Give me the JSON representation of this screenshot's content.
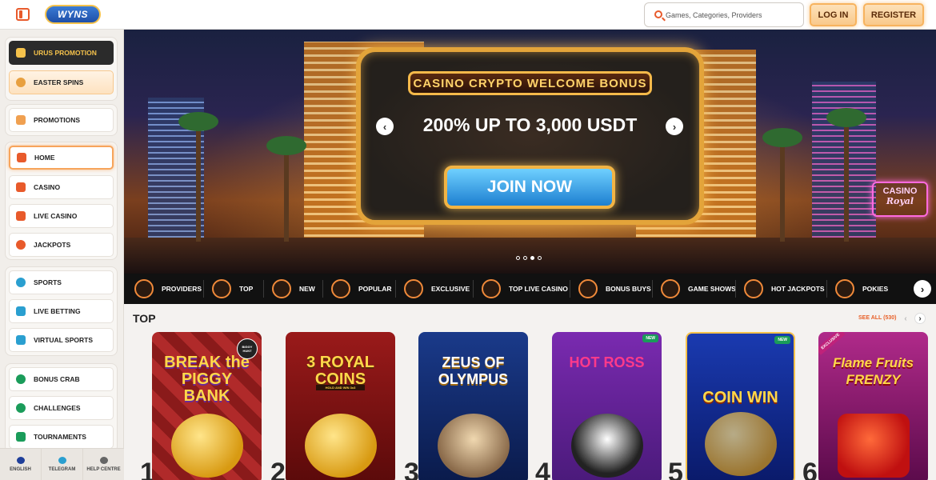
{
  "header": {
    "logo_text": "WYNS",
    "search_placeholder": "Games, Categories, Providers",
    "login_label": "LOG IN",
    "register_label": "REGISTER"
  },
  "sidebar": {
    "promo_items": [
      {
        "label": "URUS PROMOTION",
        "icon": "car-icon"
      },
      {
        "label": "EASTER SPINS",
        "icon": "easter-egg-icon"
      }
    ],
    "promotions_label": "PROMOTIONS",
    "nav_items": [
      {
        "label": "HOME",
        "icon": "home-icon"
      },
      {
        "label": "CASINO",
        "icon": "slot-machine-icon"
      },
      {
        "label": "LIVE CASINO",
        "icon": "cards-icon"
      },
      {
        "label": "JACKPOTS",
        "icon": "clover-icon"
      }
    ],
    "sports_items": [
      {
        "label": "SPORTS",
        "icon": "ball-icon"
      },
      {
        "label": "LIVE BETTING",
        "icon": "live-icon"
      },
      {
        "label": "VIRTUAL SPORTS",
        "icon": "monitor-icon"
      }
    ],
    "extra_items": [
      {
        "label": "BONUS CRAB",
        "icon": "claw-icon"
      },
      {
        "label": "CHALLENGES",
        "icon": "medal-icon"
      },
      {
        "label": "TOURNAMENTS",
        "icon": "trophy-icon"
      }
    ],
    "footer": [
      {
        "label": "ENGLISH",
        "icon": "flag-icon"
      },
      {
        "label": "TELEGRAM",
        "icon": "telegram-icon"
      },
      {
        "label": "HELP CENTRE",
        "icon": "help-icon"
      }
    ]
  },
  "banner": {
    "title": "CASINO CRYPTO WELCOME BONUS",
    "headline": "200% UP TO 3,000 USDT",
    "cta_label": "JOIN NOW",
    "sign_text": "CASINO",
    "sign_script": "Royal",
    "slides_count": 4,
    "active_slide": 2
  },
  "categories": [
    {
      "label": "PROVIDERS",
      "icon": "providers-icon"
    },
    {
      "label": "TOP",
      "icon": "crown-icon"
    },
    {
      "label": "NEW",
      "icon": "lightning-icon"
    },
    {
      "label": "POPULAR",
      "icon": "fire-icon"
    },
    {
      "label": "EXCLUSIVE",
      "icon": "diamond-icon"
    },
    {
      "label": "TOP LIVE CASINO",
      "icon": "star-icon"
    },
    {
      "label": "BONUS BUYS",
      "icon": "gift-icon"
    },
    {
      "label": "GAME SHOWS",
      "icon": "microphone-icon"
    },
    {
      "label": "HOT JACKPOTS",
      "icon": "coins-icon"
    },
    {
      "label": "POKIES",
      "icon": "slot-icon"
    }
  ],
  "top_section": {
    "title": "TOP",
    "see_all_label": "SEE ALL (530)",
    "games": [
      {
        "rank": "1",
        "title": "BREAK the PIGGY BANK",
        "badge": "BIGGY HUNT"
      },
      {
        "rank": "2",
        "title": "3 ROYAL COINS",
        "badge": "HOLD AND WIN 3x3"
      },
      {
        "rank": "3",
        "title": "ZEUS OF OLYMPUS",
        "badge": ""
      },
      {
        "rank": "4",
        "title": "HOT ROSS",
        "badge": "NEW"
      },
      {
        "rank": "5",
        "title": "COIN WIN",
        "badge": "NEW"
      },
      {
        "rank": "6",
        "title": "Flame Fruits FRENZY",
        "badge": "EXCLUSIVE"
      }
    ]
  },
  "colors": {
    "accent": "#e85a2b",
    "button_fill": "#f9c98b",
    "category_bar": "#111111"
  }
}
